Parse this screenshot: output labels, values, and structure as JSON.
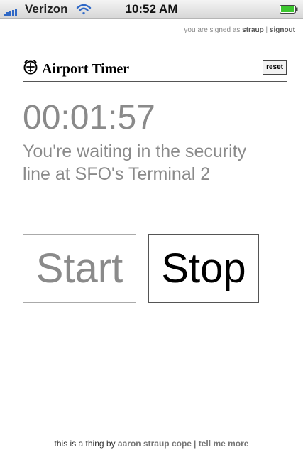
{
  "status_bar": {
    "carrier": "Verizon",
    "time": "10:52 AM",
    "signal_bars": 5,
    "battery_level": 1.0
  },
  "signin": {
    "prefix": "you are signed as",
    "user": "straup",
    "separator": "|",
    "signout": "signout"
  },
  "header": {
    "title": "Airport Timer",
    "reset_label": "reset"
  },
  "timer": {
    "elapsed": "00:01:57",
    "message": "You're waiting in the security line at SFO's Terminal 2"
  },
  "buttons": {
    "start": "Start",
    "stop": "Stop"
  },
  "footer": {
    "prefix": "this is a thing by",
    "author": "aaron straup cope",
    "separator": "|",
    "more": "tell me more"
  },
  "colors": {
    "muted_text": "#8a8a8a",
    "signal_blue": "#2f68c6",
    "battery_green": "#3cc62f"
  }
}
